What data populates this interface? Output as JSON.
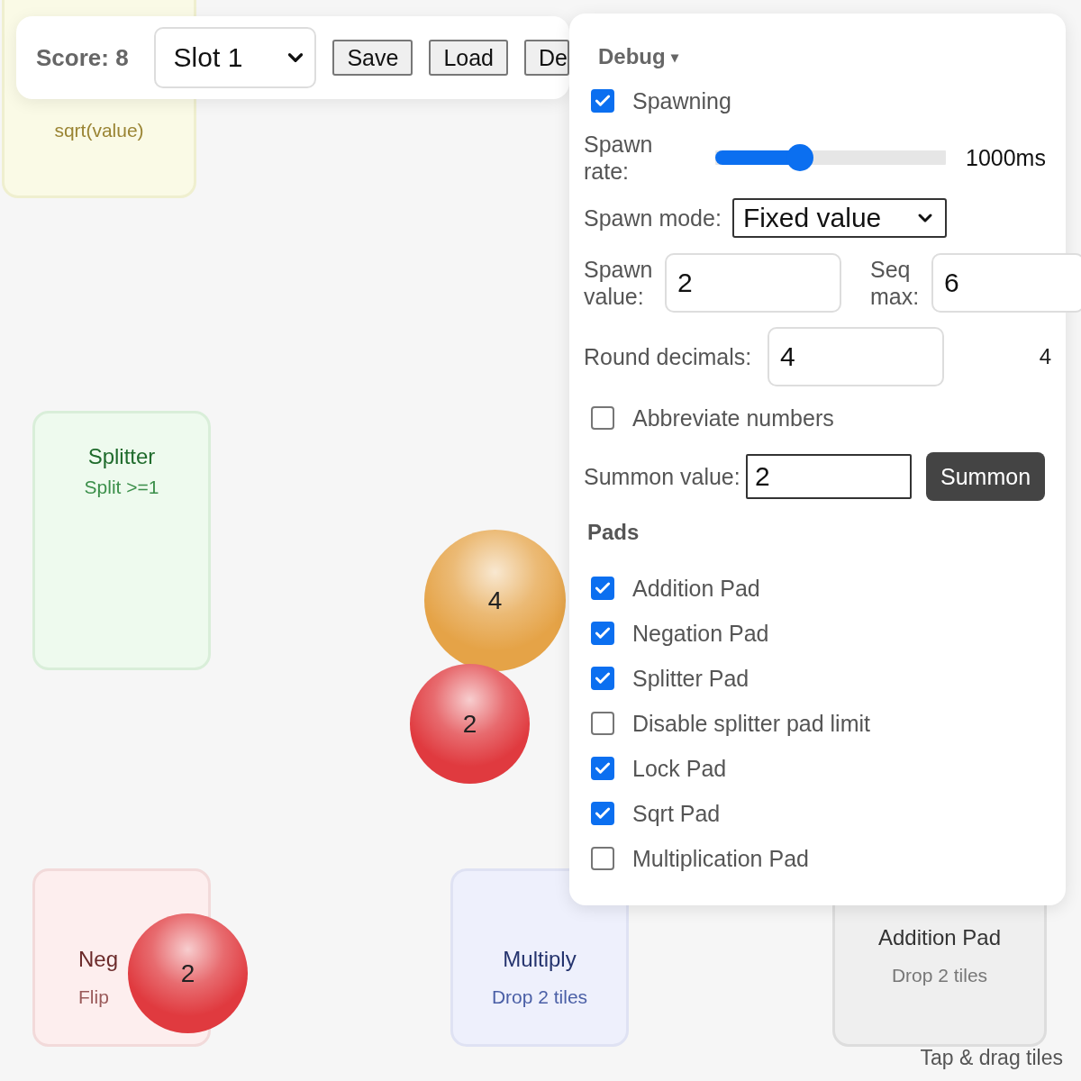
{
  "toolbar": {
    "score": "Score: 8",
    "slot": "Slot 1",
    "buttons": [
      "Save",
      "Load",
      "De"
    ]
  },
  "pads": [
    {
      "kind": "sqrt",
      "desc": "sqrt(value)"
    },
    {
      "kind": "splitter",
      "title": "Splitter",
      "desc": "Split >=1"
    },
    {
      "kind": "negation",
      "title": "Neg",
      "desc": "Flip"
    },
    {
      "kind": "multiply",
      "title": "Multiply",
      "desc": "Drop 2 tiles"
    },
    {
      "kind": "addition",
      "title": "Addition Pad",
      "desc": "Drop 2 tiles"
    }
  ],
  "tiles": [
    {
      "value": "4",
      "color": "#e5a347"
    },
    {
      "value": "2",
      "color": "#e03a3f"
    },
    {
      "value": "2",
      "color": "#e03a3f"
    }
  ],
  "debug": {
    "title": "Debug",
    "caret": "▾",
    "spawning": {
      "label": "Spawning",
      "checked": true
    },
    "spawn_rate": {
      "label": "Spawn rate:",
      "level": 0.35,
      "reading": "1000ms"
    },
    "spawn_mode": {
      "label": "Spawn mode:",
      "value": "Fixed value"
    },
    "spawn_value": {
      "label": "Spawn value:",
      "value": "2"
    },
    "seq_max": {
      "label": "Seq max:",
      "value": "6"
    },
    "round_decimals": {
      "label": "Round decimals:",
      "value": "4",
      "reading": "4"
    },
    "abbreviate": {
      "label": "Abbreviate numbers",
      "checked": false
    },
    "summon": {
      "label": "Summon value:",
      "value": "2",
      "button": "Summon"
    },
    "pads_heading": "Pads",
    "pad_options": [
      {
        "label": "Addition Pad",
        "checked": true
      },
      {
        "label": "Negation Pad",
        "checked": true
      },
      {
        "label": "Splitter Pad",
        "checked": true
      },
      {
        "label": "Disable splitter pad limit",
        "checked": false
      },
      {
        "label": "Lock Pad",
        "checked": true
      },
      {
        "label": "Sqrt Pad",
        "checked": true
      },
      {
        "label": "Multiplication Pad",
        "checked": false
      }
    ]
  },
  "hint": "Tap & drag tiles"
}
